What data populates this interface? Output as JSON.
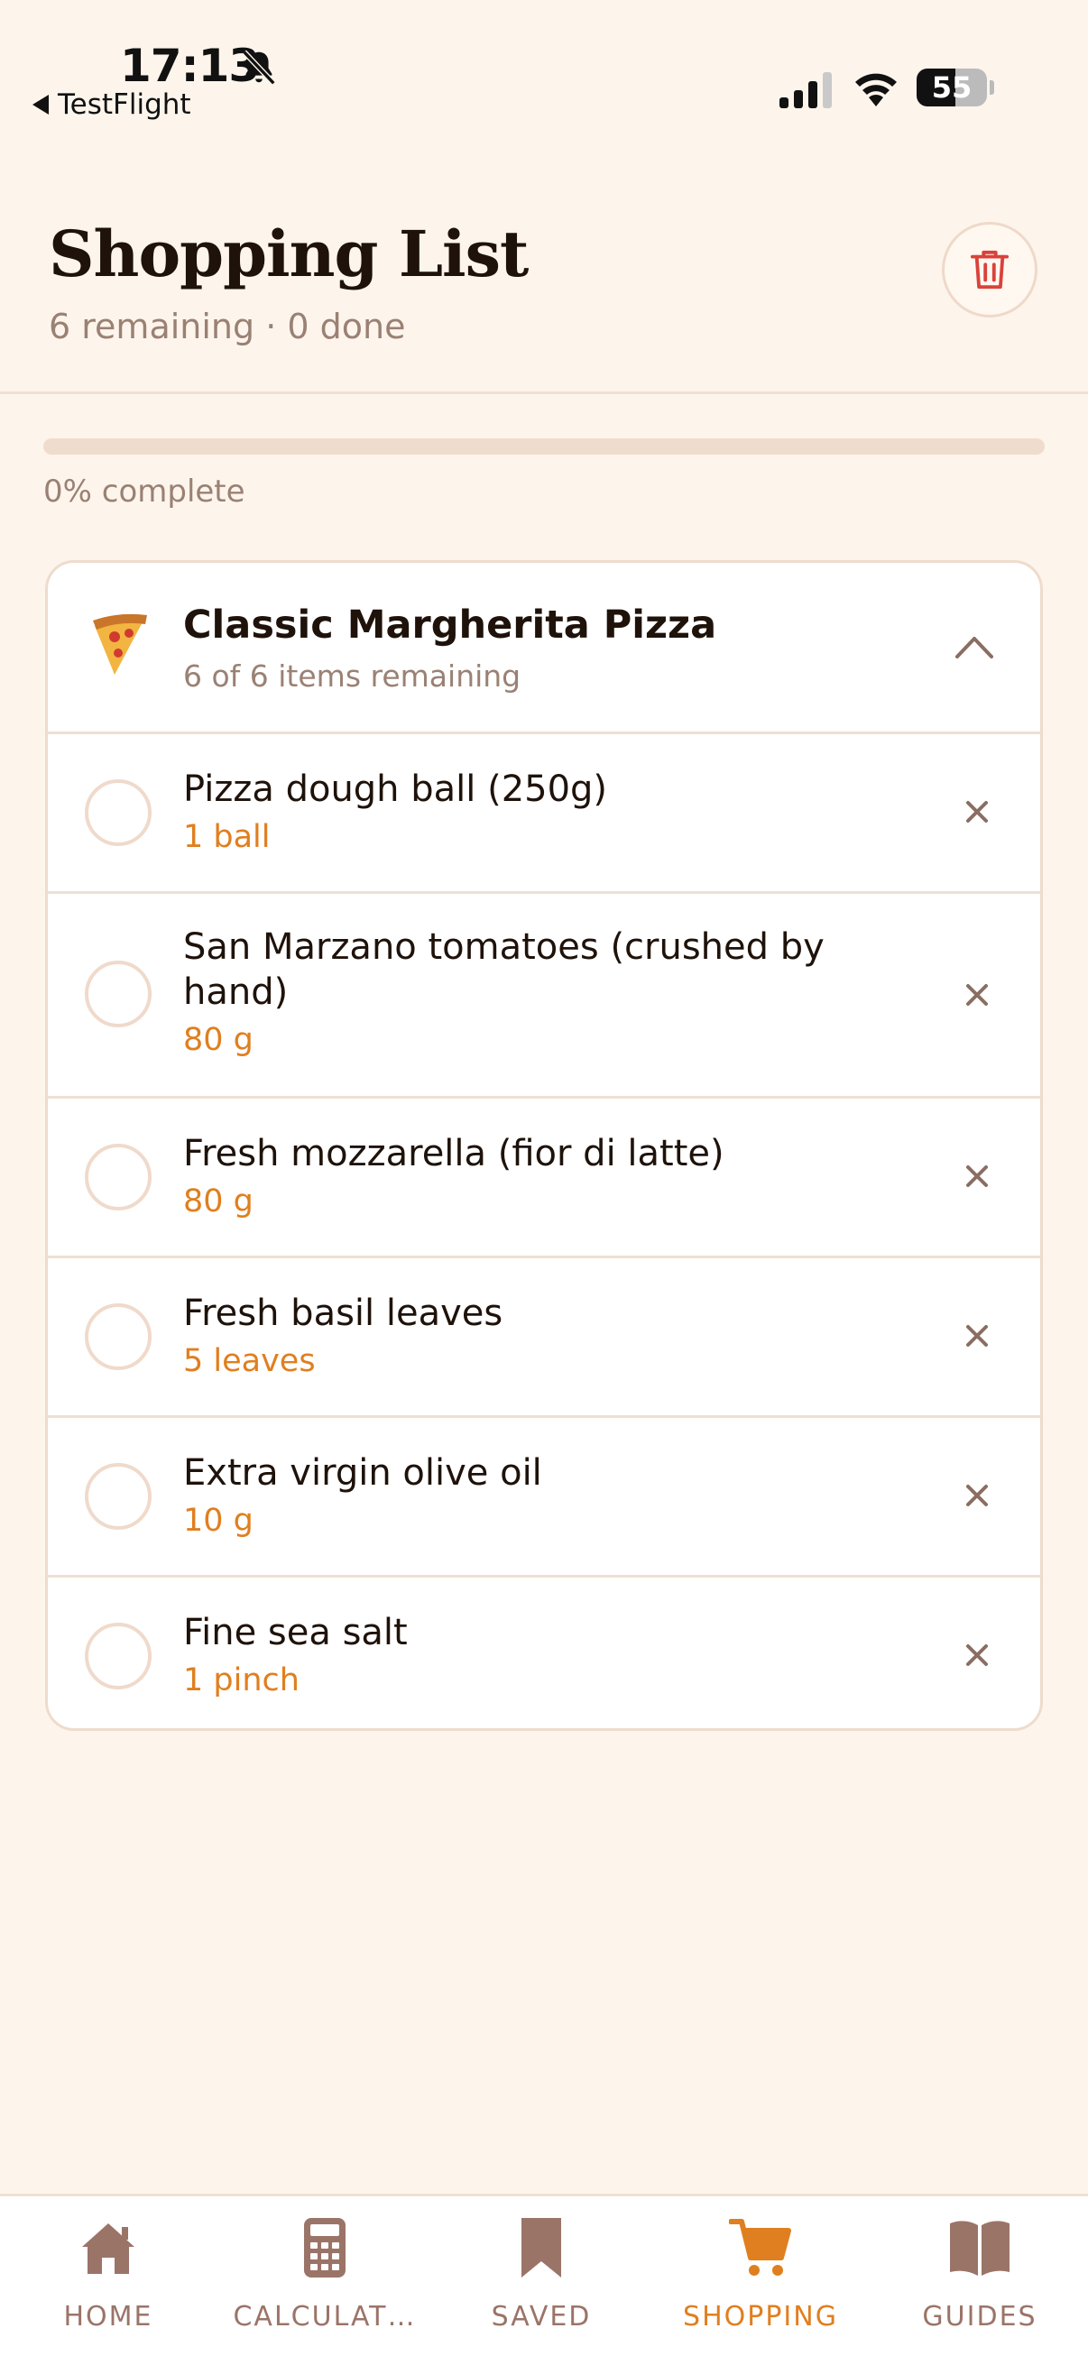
{
  "status_bar": {
    "time": "17:13",
    "back_app": "TestFlight",
    "battery_level": "55"
  },
  "header": {
    "title": "Shopping List",
    "remaining_count": "6 remaining",
    "separator": "·",
    "done_count": "0 done"
  },
  "progress": {
    "percent": 0,
    "label": "0% complete"
  },
  "recipe": {
    "title": "Classic Margherita Pizza",
    "remaining": "6 of 6 items remaining",
    "items": [
      {
        "name": "Pizza dough ball (250g)",
        "qty": "1 ball"
      },
      {
        "name": "San Marzano tomatoes (crushed by hand)",
        "qty": "80 g"
      },
      {
        "name": "Fresh mozzarella (fior di latte)",
        "qty": "80 g"
      },
      {
        "name": "Fresh basil leaves",
        "qty": "5 leaves"
      },
      {
        "name": "Extra virgin olive oil",
        "qty": "10 g"
      },
      {
        "name": "Fine sea salt",
        "qty": "1 pinch"
      }
    ]
  },
  "tabs": [
    {
      "label": "HOME",
      "icon": "home-icon",
      "active": false
    },
    {
      "label": "CALCULAT…",
      "icon": "calculator-icon",
      "active": false
    },
    {
      "label": "SAVED",
      "icon": "bookmark-icon",
      "active": false
    },
    {
      "label": "SHOPPING",
      "icon": "cart-icon",
      "active": true
    },
    {
      "label": "GUIDES",
      "icon": "book-icon",
      "active": false
    }
  ],
  "colors": {
    "accent": "#e07f1f",
    "muted": "#9a8174",
    "danger": "#d9423a",
    "tab_inactive": "#9b7468"
  }
}
